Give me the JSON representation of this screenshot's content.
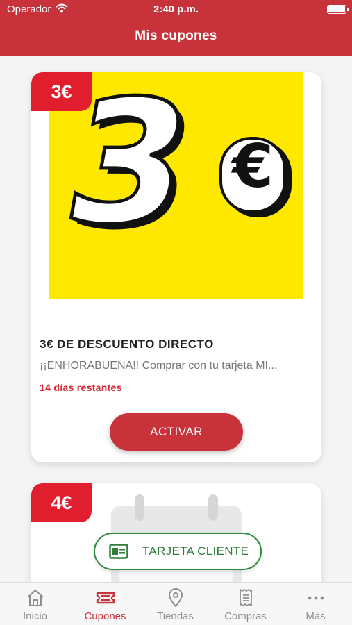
{
  "status": {
    "carrier": "Operador",
    "time": "2:40 p.m."
  },
  "header": {
    "title": "Mis cupones"
  },
  "coupons": [
    {
      "badge": "3€",
      "image_number": "3",
      "image_currency": "€",
      "title": "3€ DE DESCUENTO DIRECTO",
      "description": "¡¡ENHORABUENA!! Comprar con tu tarjeta MI...",
      "days_left": "14 días restantes",
      "action_label": "ACTIVAR"
    },
    {
      "badge": "4€"
    }
  ],
  "fab": {
    "label": "TARJETA CLIENTE",
    "icon": "id-card-icon"
  },
  "tabs": [
    {
      "label": "Inicio",
      "icon": "home-icon",
      "active": false
    },
    {
      "label": "Cupones",
      "icon": "ticket-icon",
      "active": true
    },
    {
      "label": "Tiendas",
      "icon": "location-pin-icon",
      "active": false
    },
    {
      "label": "Compras",
      "icon": "receipt-icon",
      "active": false
    },
    {
      "label": "Más",
      "icon": "more-dots-icon",
      "active": false
    }
  ],
  "colors": {
    "brand_red": "#c8323a",
    "badge_red": "#e01e2d",
    "accent_green": "#2e8b3e",
    "coupon_yellow": "#ffe800"
  }
}
